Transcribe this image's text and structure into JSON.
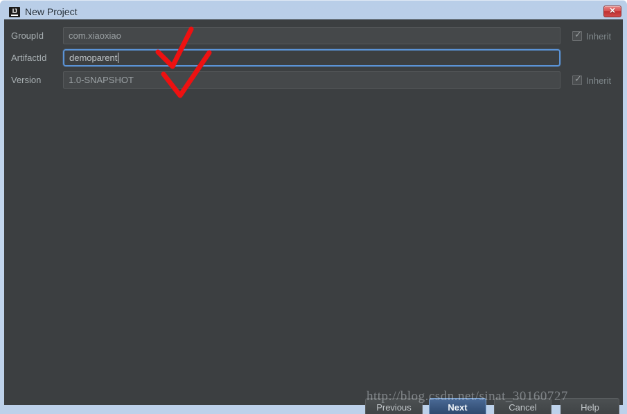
{
  "window": {
    "title": "New Project",
    "icon": "intellij-idea-icon",
    "close_label": "✕",
    "frame_color": "#c3d6ec",
    "content_bg": "#3c3f41"
  },
  "form": {
    "rows": [
      {
        "label": "GroupId",
        "value": "com.xiaoxiao",
        "placeholder": "GroupId",
        "focused": false,
        "inherit": {
          "label": "Inherit",
          "checked": true,
          "disabled": true
        }
      },
      {
        "label": "ArtifactId",
        "value": "demoparent",
        "placeholder": "ArtifactId",
        "focused": true,
        "inherit": null
      },
      {
        "label": "Version",
        "value": "1.0-SNAPSHOT",
        "placeholder": "Version",
        "focused": false,
        "inherit": {
          "label": "Inherit",
          "checked": true,
          "disabled": true
        }
      }
    ]
  },
  "buttons": {
    "previous": "Previous",
    "next": "Next",
    "cancel": "Cancel",
    "help": "Help"
  },
  "annotations": {
    "checkmark_color": "#ee1111",
    "marks": [
      {
        "name": "red-checkmark-groupid"
      },
      {
        "name": "red-checkmark-artifactid"
      }
    ]
  },
  "watermark": {
    "text": "http://blog.csdn.net/sinat_30160727"
  }
}
